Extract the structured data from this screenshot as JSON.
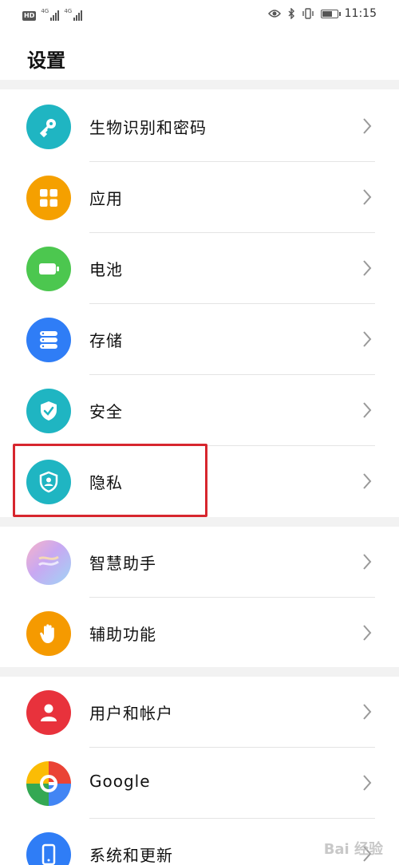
{
  "status_bar": {
    "hd": "HD",
    "signal1_label": "4G",
    "signal2_label": "4G",
    "time": "11:15"
  },
  "page": {
    "title": "设置"
  },
  "groups": [
    {
      "items": [
        {
          "label": "生物识别和密码",
          "icon": "key-icon",
          "color": "#1fb5c2"
        },
        {
          "label": "应用",
          "icon": "apps-grid-icon",
          "color": "#f5a000"
        },
        {
          "label": "电池",
          "icon": "battery-icon",
          "color": "#4cc74f"
        },
        {
          "label": "存储",
          "icon": "storage-icon",
          "color": "#2f7df6"
        },
        {
          "label": "安全",
          "icon": "shield-check-icon",
          "color": "#1fb5c2"
        },
        {
          "label": "隐私",
          "icon": "privacy-shield-icon",
          "color": "#1fb5c2"
        }
      ]
    },
    {
      "items": [
        {
          "label": "智慧助手",
          "icon": "smart-assistant-icon",
          "color": "#c9a7f0"
        },
        {
          "label": "辅助功能",
          "icon": "hand-icon",
          "color": "#f59a00"
        }
      ]
    },
    {
      "items": [
        {
          "label": "用户和帐户",
          "icon": "user-icon",
          "color": "#e8323c"
        },
        {
          "label": "Google",
          "icon": "google-icon",
          "color": "#ffffff"
        },
        {
          "label": "系统和更新",
          "icon": "phone-update-icon",
          "color": "#2f7df6"
        }
      ]
    }
  ],
  "watermark": "Bai 经验"
}
